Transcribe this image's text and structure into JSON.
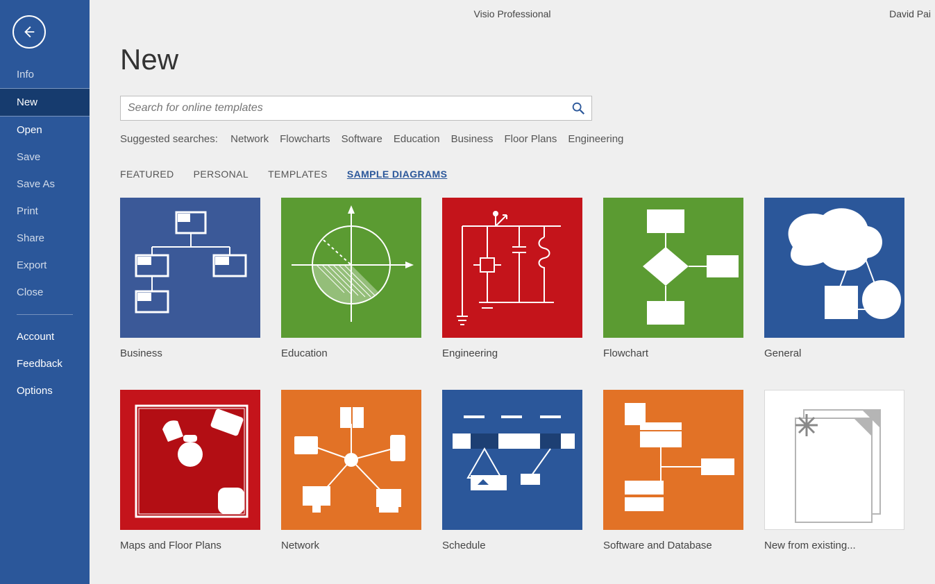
{
  "titlebar": {
    "app_title": "Visio Professional",
    "user": "David Pai"
  },
  "sidebar": {
    "items": [
      {
        "label": "Info",
        "primary": false
      },
      {
        "label": "New",
        "primary": true,
        "selected": true
      },
      {
        "label": "Open",
        "primary": true
      },
      {
        "label": "Save",
        "primary": false
      },
      {
        "label": "Save As",
        "primary": false
      },
      {
        "label": "Print",
        "primary": false
      },
      {
        "label": "Share",
        "primary": false
      },
      {
        "label": "Export",
        "primary": false
      },
      {
        "label": "Close",
        "primary": false
      }
    ],
    "footer": [
      {
        "label": "Account"
      },
      {
        "label": "Feedback"
      },
      {
        "label": "Options"
      }
    ]
  },
  "page": {
    "title": "New",
    "search_placeholder": "Search for online templates",
    "suggest_label": "Suggested searches:",
    "suggested": [
      "Network",
      "Flowcharts",
      "Software",
      "Education",
      "Business",
      "Floor Plans",
      "Engineering"
    ],
    "tabs": [
      "FEATURED",
      "PERSONAL",
      "TEMPLATES",
      "SAMPLE DIAGRAMS"
    ],
    "active_tab": "SAMPLE DIAGRAMS",
    "templates": [
      {
        "label": "Business",
        "color": "bg-blue",
        "icon": "org-chart"
      },
      {
        "label": "Education",
        "color": "bg-green",
        "icon": "pie-axes"
      },
      {
        "label": "Engineering",
        "color": "bg-red",
        "icon": "circuit"
      },
      {
        "label": "Flowchart",
        "color": "bg-green",
        "icon": "flowchart"
      },
      {
        "label": "General",
        "color": "bg-blue2",
        "icon": "shapes"
      },
      {
        "label": "Maps and Floor Plans",
        "color": "bg-red",
        "icon": "floorplan"
      },
      {
        "label": "Network",
        "color": "bg-orange",
        "icon": "network"
      },
      {
        "label": "Schedule",
        "color": "bg-blue2",
        "icon": "schedule"
      },
      {
        "label": "Software and Database",
        "color": "bg-orange",
        "icon": "database"
      },
      {
        "label": "New from existing...",
        "color": "bg-white",
        "icon": "new-existing"
      }
    ]
  }
}
